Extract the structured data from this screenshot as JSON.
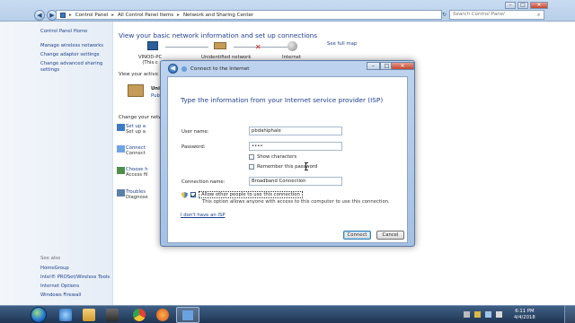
{
  "address_bar": {
    "crumbs": [
      "Control Panel",
      "All Control Panel Items",
      "Network and Sharing Center"
    ],
    "search_placeholder": "Search Control Panel"
  },
  "left_panel": {
    "home": "Control Panel Home",
    "links": [
      "Manage wireless networks",
      "Change adapter settings",
      "Change advanced sharing",
      "settings"
    ],
    "see_also_header": "See also",
    "see_also": [
      "HomeGroup",
      "Intel® PROSet/Wireless Tools",
      "Internet Options",
      "Windows Firewall"
    ]
  },
  "main": {
    "heading": "View your basic network information and set up connections",
    "see_full_map": "See full map",
    "map": {
      "node1": "VINOD-PC",
      "node1_sub": "(This c",
      "node2": "Unidentified network",
      "node3": "Internet"
    },
    "view_active": "View your active ne",
    "active_lines": [
      "Unid",
      "Publi"
    ],
    "change_settings": "Change your netw",
    "tasks": [
      {
        "t1": "Set up a",
        "t2": "Set up a"
      },
      {
        "t1": "Connect",
        "t2": "Connect"
      },
      {
        "t1": "Choose h",
        "t2": "Access fil"
      },
      {
        "t1": "Troubles",
        "t2": "Diagnose"
      }
    ]
  },
  "dialog": {
    "title": "Connect to the Internet",
    "heading": "Type the information from your Internet service provider (ISP)",
    "username_label": "User name:",
    "username_value": "pbdahiphale",
    "password_label": "Password:",
    "password_value": "••••",
    "show_characters": "Show characters",
    "remember_password": "Remember this password",
    "connection_name_label": "Connection name:",
    "connection_name_value": "Broadband Connection",
    "allow_others": "Allow other people to use this connection",
    "allow_desc": "This option allows anyone with access to this computer to use this connection.",
    "no_isp": "I don't have an ISP",
    "connect_button": "Connect",
    "cancel_button": "Cancel"
  },
  "taskbar": {
    "time": "6:11 PM",
    "date": "4/4/2018"
  }
}
